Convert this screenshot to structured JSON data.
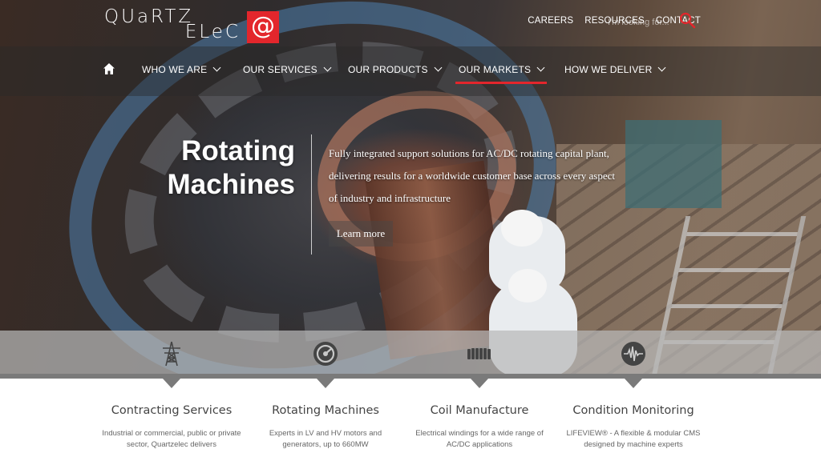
{
  "brand": {
    "logo_line1": "QUaRTZ",
    "logo_line2": "ELeC",
    "logo_mark": "@",
    "accent_color": "#e3262c"
  },
  "utility_nav": {
    "careers": "CAREERS",
    "resources": "RESOURCES",
    "contact": "CONTACT"
  },
  "search": {
    "placeholder": "I'm looking for..."
  },
  "main_nav": {
    "items": [
      {
        "label": "WHO WE ARE"
      },
      {
        "label": "OUR SERVICES"
      },
      {
        "label": "OUR PRODUCTS"
      },
      {
        "label": "OUR MARKETS",
        "active": true
      },
      {
        "label": "HOW WE DELIVER"
      }
    ]
  },
  "hero": {
    "title_line1": "Rotating",
    "title_line2": "Machines",
    "description": "Fully integrated support solutions for AC/DC rotating capital plant, delivering results for a worldwide customer base across every aspect of industry and infrastructure",
    "cta": "Learn more"
  },
  "services": [
    {
      "icon": "pylon-icon",
      "title": "Contracting Services",
      "desc": "Industrial or commercial, public or private sector, Quartzelec delivers"
    },
    {
      "icon": "rotating-gauge-icon",
      "title": "Rotating Machines",
      "desc": "Experts in LV and HV motors and generators, up to 660MW"
    },
    {
      "icon": "coil-icon",
      "title": "Coil Manufacture",
      "desc": "Electrical windings for a wide range of AC/DC applications"
    },
    {
      "icon": "waveform-icon",
      "title": "Condition Monitoring",
      "desc": "LIFEVIEW® - A flexible & modular CMS designed by machine experts"
    }
  ]
}
